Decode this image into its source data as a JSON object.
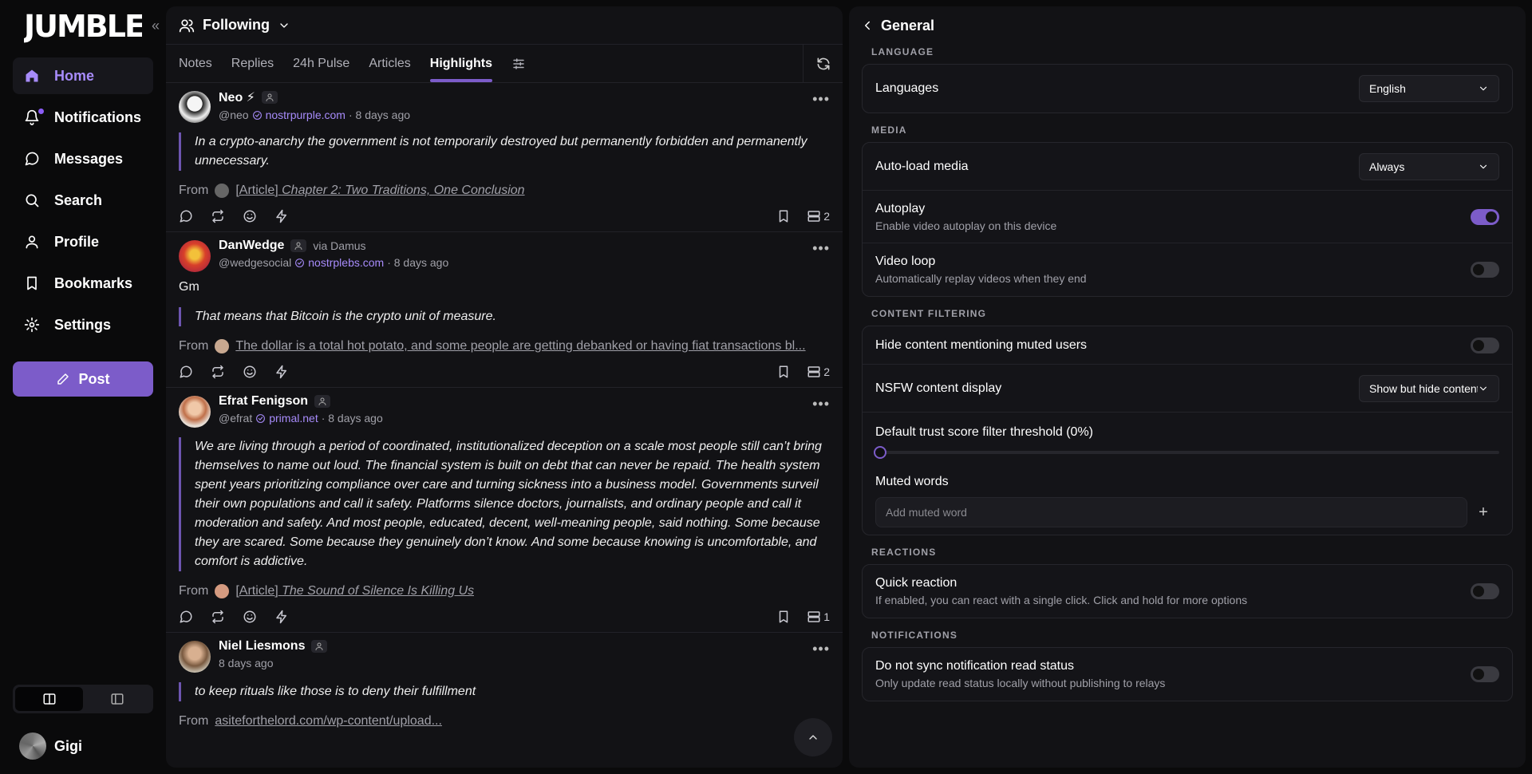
{
  "app": {
    "logo_text": "JUMBLE"
  },
  "sidebar": {
    "items": [
      {
        "label": "Home",
        "icon": "home-icon"
      },
      {
        "label": "Notifications",
        "icon": "bell-icon"
      },
      {
        "label": "Messages",
        "icon": "message-icon"
      },
      {
        "label": "Search",
        "icon": "search-icon"
      },
      {
        "label": "Profile",
        "icon": "user-icon"
      },
      {
        "label": "Bookmarks",
        "icon": "bookmark-icon"
      },
      {
        "label": "Settings",
        "icon": "gear-icon"
      }
    ],
    "post_label": "Post",
    "account_name": "Gigi"
  },
  "feed": {
    "header": "Following",
    "tabs": [
      "Notes",
      "Replies",
      "24h Pulse",
      "Articles",
      "Highlights"
    ],
    "posts": [
      {
        "name": "Neo ⚡",
        "handle": "@neo",
        "domain": "nostrpurple.com",
        "time": "· 8 days ago",
        "quote": "In a crypto-anarchy the government is not temporarily destroyed but permanently forbidden and permanently unnecessary.",
        "from_label": "From",
        "from_prefix": "[Article]",
        "from_title": "Chapter 2: Two Traditions, One Conclusion",
        "count": "2"
      },
      {
        "name": "DanWedge",
        "via": "via Damus",
        "handle": "@wedgesocial",
        "domain": "nostrplebs.com",
        "time": "· 8 days ago",
        "plain": "Gm",
        "quote": "That means that Bitcoin is the crypto unit of measure.",
        "from_label": "From",
        "from_title": "The dollar is a total hot potato, and some people are getting debanked or having fiat transactions bl...",
        "count": "2"
      },
      {
        "name": "Efrat Fenigson",
        "handle": "@efrat",
        "domain": "primal.net",
        "time": "· 8 days ago",
        "quote": "We are living through a period of coordinated, institutionalized deception on a scale most people still can’t bring themselves to name out loud. The financial system is built on debt that can never be repaid. The health system spent years prioritizing compliance over care and turning sickness into a business model. Governments surveil their own populations and call it safety. Platforms silence doctors, journalists, and ordinary people and call it moderation and safety. And most people, educated, decent, well-meaning people, said nothing. Some because they are scared. Some because they genuinely don’t know. And some because knowing is uncomfortable, and comfort is addictive.",
        "from_label": "From",
        "from_prefix": "[Article]",
        "from_title": "The Sound of Silence Is Killing Us",
        "count": "1"
      },
      {
        "name": "Niel Liesmons",
        "time": "8 days ago",
        "quote": "to keep rituals like those is to deny their fulfillment",
        "from_label": "From",
        "from_title": "asiteforthelord.com/wp-content/upload..."
      }
    ]
  },
  "settings": {
    "title": "General",
    "sections": {
      "language": "LANGUAGE",
      "media": "MEDIA",
      "content_filtering": "CONTENT FILTERING",
      "reactions": "REACTIONS",
      "notifications": "NOTIFICATIONS"
    },
    "languages_label": "Languages",
    "languages_value": "English",
    "autoload_label": "Auto-load media",
    "autoload_value": "Always",
    "autoplay_label": "Autoplay",
    "autoplay_desc": "Enable video autoplay on this device",
    "autoplay_on": true,
    "videoloop_label": "Video loop",
    "videoloop_desc": "Automatically replay videos when they end",
    "videoloop_on": false,
    "hide_muted_label": "Hide content mentioning muted users",
    "hide_muted_on": false,
    "nsfw_label": "NSFW content display",
    "nsfw_value": "Show but hide content",
    "trust_label": "Default trust score filter threshold (0%)",
    "trust_value": 0,
    "muted_words_label": "Muted words",
    "muted_words_placeholder": "Add muted word",
    "quick_reaction_label": "Quick reaction",
    "quick_reaction_desc": "If enabled, you can react with a single click. Click and hold for more options",
    "quick_reaction_on": false,
    "sync_label": "Do not sync notification read status",
    "sync_desc": "Only update read status locally without publishing to relays",
    "sync_on": false
  },
  "colors": {
    "accent": "#7c5cc9",
    "accent_light": "#a78bfa",
    "background": "#0a0a0b",
    "panel": "#121215"
  }
}
